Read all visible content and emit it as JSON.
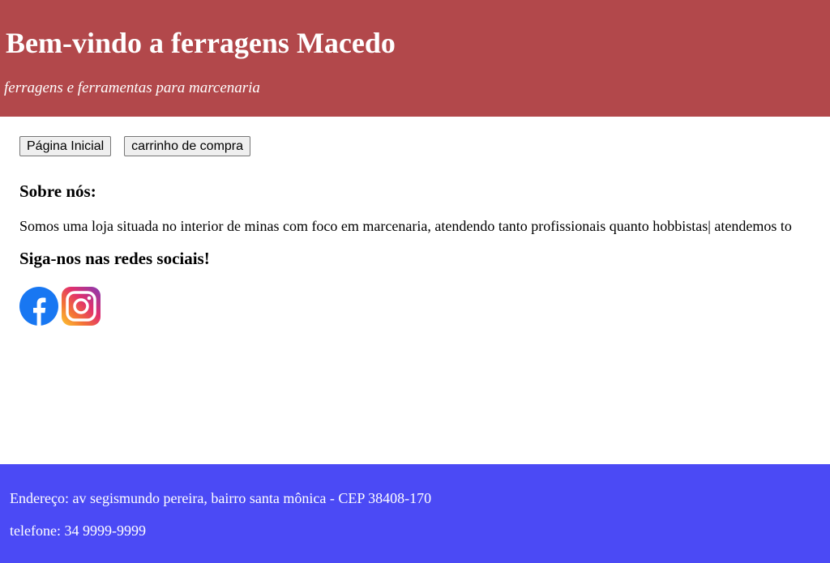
{
  "header": {
    "title": "Bem-vindo a ferragens Macedo",
    "subtitle": "ferragens e ferramentas para marcenaria",
    "background_color": "#b2484b"
  },
  "nav": {
    "home_label": "Página Inicial",
    "cart_label": "carrinho de compra"
  },
  "about": {
    "heading": "Sobre nós:",
    "text": "Somos uma loja situada no interior de minas com foco em marcenaria, atendendo tanto profissionais quanto hobbistas| atendemos to"
  },
  "social": {
    "heading": "Siga-nos nas redes sociais!",
    "icons": [
      "facebook-icon",
      "instagram-icon"
    ]
  },
  "footer": {
    "address": "Endereço: av segismundo pereira, bairro santa mônica - CEP 38408-170",
    "phone": "telefone: 34 9999-9999",
    "background_color": "#4b4af5"
  }
}
